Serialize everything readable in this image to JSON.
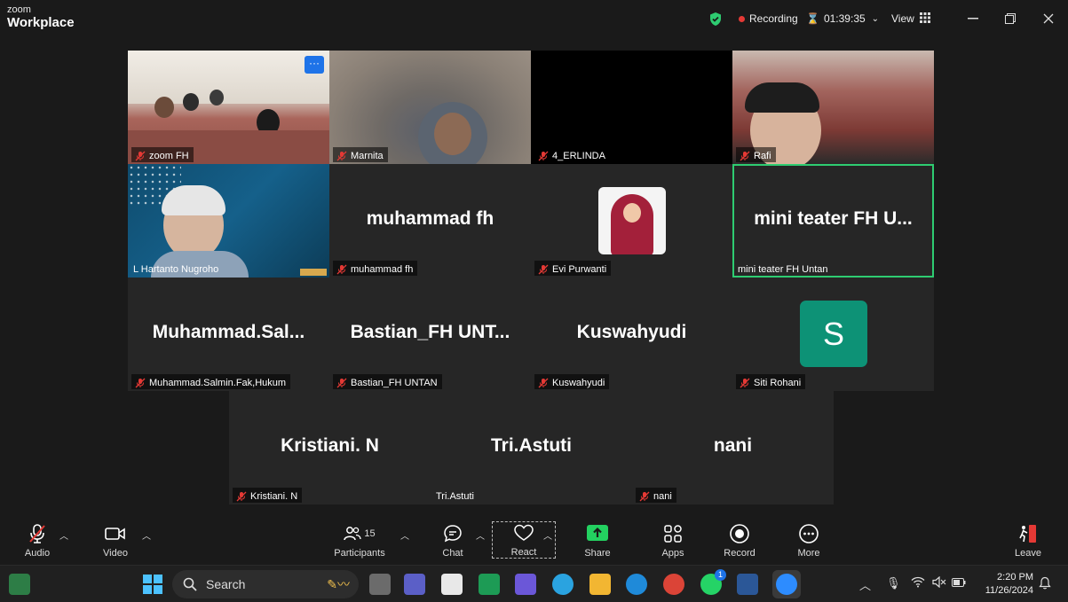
{
  "app": {
    "brand_small": "zoom",
    "brand_big": "Workplace"
  },
  "titlebar": {
    "recording_label": "Recording",
    "timer": "01:39:35",
    "view_label": "View"
  },
  "tiles": [
    {
      "name": "zoom FH"
    },
    {
      "name": "Marnita"
    },
    {
      "name": "4_ERLINDA"
    },
    {
      "name": "Rafi"
    },
    {
      "name": "L Hartanto Nugroho"
    },
    {
      "name": "muhammad fh",
      "display": "muhammad fh"
    },
    {
      "name": "Evi Purwanti"
    },
    {
      "name": "mini teater FH Untan",
      "display": "mini teater FH U..."
    },
    {
      "name": "Muhammad.Salmin.Fak,Hukum",
      "display": "Muhammad.Sal..."
    },
    {
      "name": "Bastian_FH UNTAN",
      "display": "Bastian_FH UNT..."
    },
    {
      "name": "Kuswahyudi",
      "display": "Kuswahyudi"
    },
    {
      "name": "Siti Rohani",
      "avatar_letter": "S"
    },
    {
      "name": "Kristiani. N",
      "display": "Kristiani. N"
    },
    {
      "name": "Tri.Astuti",
      "display": "Tri.Astuti"
    },
    {
      "name": "nani",
      "display": "nani"
    }
  ],
  "toolbar": {
    "audio": "Audio",
    "video": "Video",
    "participants": "Participants",
    "participants_count": "15",
    "chat": "Chat",
    "react": "React",
    "share": "Share",
    "apps": "Apps",
    "record": "Record",
    "more": "More",
    "leave": "Leave"
  },
  "taskbar": {
    "search_label": "Search",
    "time": "2:20 PM",
    "date": "11/26/2024",
    "whatsapp_badge": "1"
  },
  "colors": {
    "active_speaker": "#2ecc71",
    "recording_dot": "#e53935",
    "share_green": "#23d160",
    "avatar_teal": "#0d9276"
  }
}
